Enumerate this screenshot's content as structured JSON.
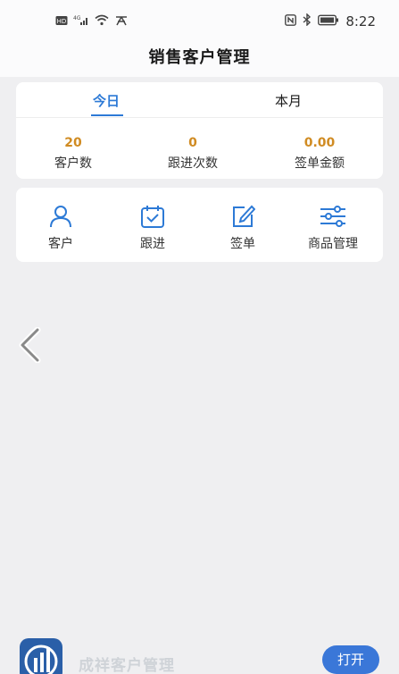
{
  "status_bar": {
    "left_icons": [
      "hd-icon",
      "signal-icon",
      "wifi-icon",
      "data-icon"
    ],
    "right_icons": [
      "nfc-icon",
      "bluetooth-icon",
      "battery-icon"
    ],
    "time": "8:22"
  },
  "header": {
    "title": "销售客户管理"
  },
  "tabs": [
    {
      "label": "今日",
      "active": true
    },
    {
      "label": "本月",
      "active": false
    }
  ],
  "stats": [
    {
      "value": "20",
      "label": "客户数"
    },
    {
      "value": "0",
      "label": "跟进次数"
    },
    {
      "value": "0.00",
      "label": "签单金额"
    }
  ],
  "actions": [
    {
      "label": "客户",
      "icon": "person-icon"
    },
    {
      "label": "跟进",
      "icon": "calendar-check-icon"
    },
    {
      "label": "签单",
      "icon": "edit-icon"
    },
    {
      "label": "商品管理",
      "icon": "sliders-icon"
    }
  ],
  "banner": {
    "app_name": "成祥客户管理",
    "open_label": "打开"
  },
  "colors": {
    "accent": "#2d7ad6",
    "stat_number": "#d08b22",
    "open_button": "#3a77d8"
  }
}
